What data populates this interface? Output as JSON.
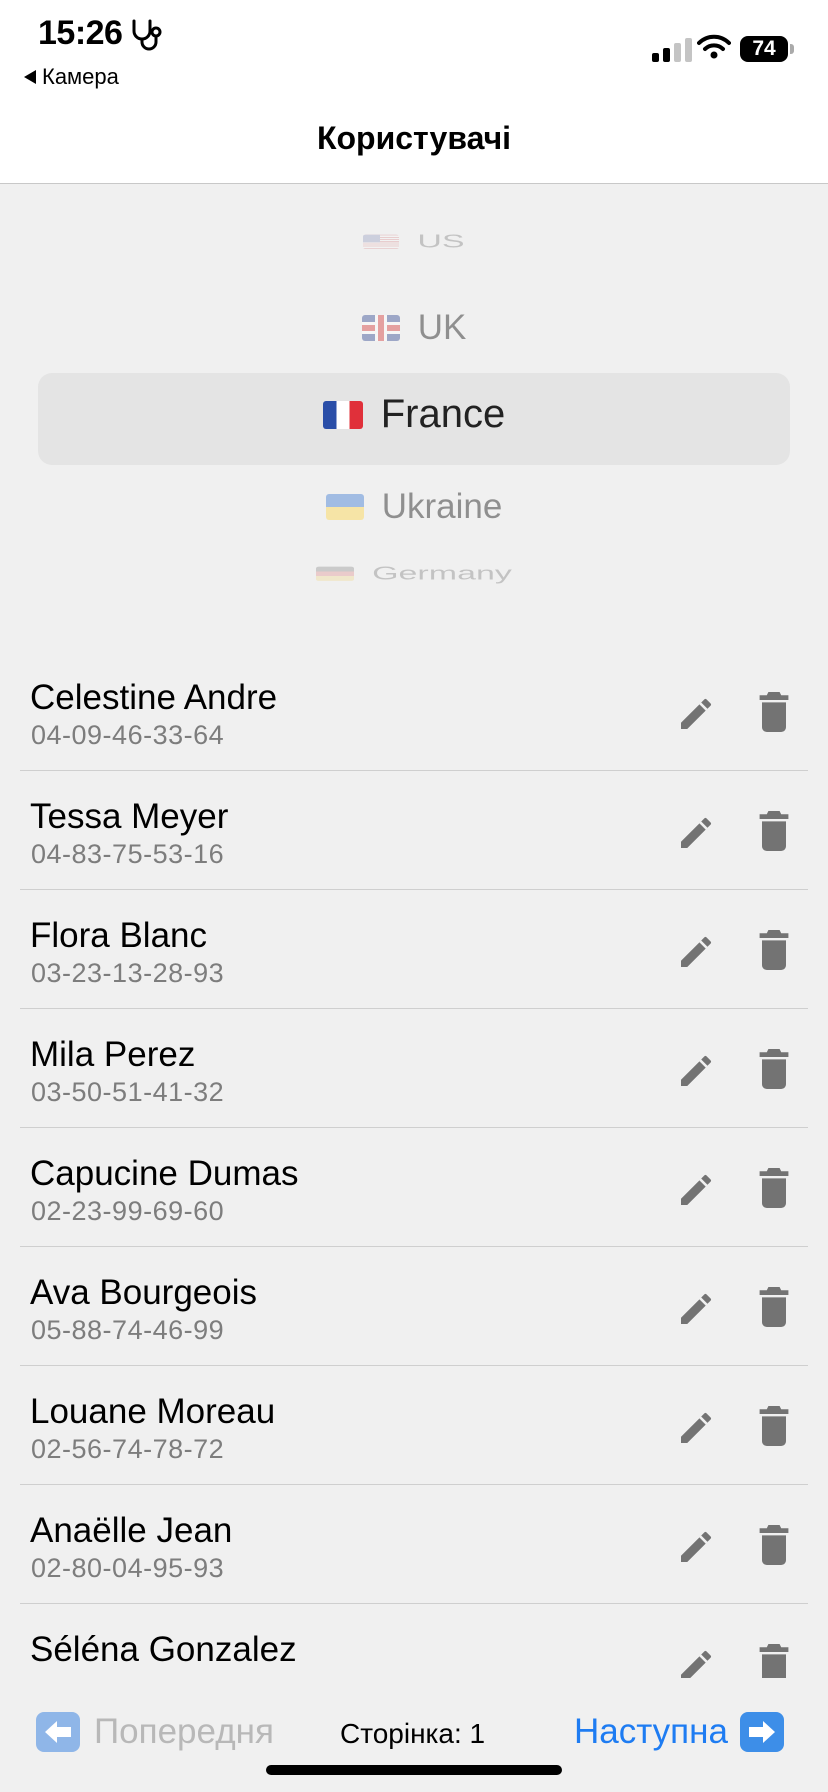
{
  "status_bar": {
    "time": "15:26",
    "back_app": "Камера",
    "battery": "74",
    "icons": [
      "stethoscope-icon",
      "signal-icon",
      "wifi-icon",
      "battery-icon"
    ]
  },
  "nav": {
    "title": "Користувачі"
  },
  "picker": {
    "items": [
      {
        "label": "US",
        "flag": "flag-us"
      },
      {
        "label": "UK",
        "flag": "flag-uk"
      },
      {
        "label": "France",
        "flag": "flag-fr"
      },
      {
        "label": "Ukraine",
        "flag": "flag-ua"
      },
      {
        "label": "Germany",
        "flag": "flag-de"
      }
    ],
    "selected": "France"
  },
  "users": [
    {
      "name": "Celestine Andre",
      "phone": "04-09-46-33-64"
    },
    {
      "name": "Tessa Meyer",
      "phone": "04-83-75-53-16"
    },
    {
      "name": "Flora Blanc",
      "phone": "03-23-13-28-93"
    },
    {
      "name": "Mila Perez",
      "phone": "03-50-51-41-32"
    },
    {
      "name": "Capucine Dumas",
      "phone": "02-23-99-69-60"
    },
    {
      "name": "Ava Bourgeois",
      "phone": "05-88-74-46-99"
    },
    {
      "name": "Louane Moreau",
      "phone": "02-56-74-78-72"
    },
    {
      "name": "Anaëlle Jean",
      "phone": "02-80-04-95-93"
    },
    {
      "name": "Séléna Gonzalez",
      "phone": ""
    }
  ],
  "pagination": {
    "prev_label": "Попередня",
    "page_label": "Сторінка: 1",
    "next_label": "Наступна"
  },
  "colors": {
    "accent": "#1e7cf2",
    "disabled": "#b8b8b8",
    "icon_gray": "#737373",
    "background": "#f0f0f0"
  }
}
